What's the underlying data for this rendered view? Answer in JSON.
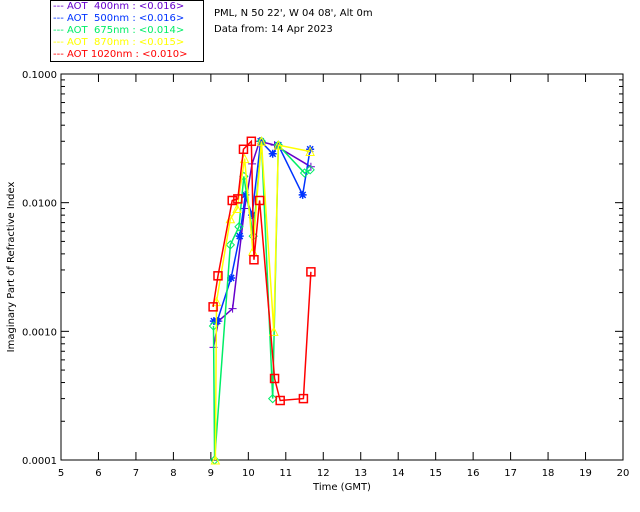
{
  "header": {
    "site": "PML, N 50 22', W 04 08', Alt 0m",
    "date": "Data from: 14 Apr 2023"
  },
  "chart_data": {
    "type": "line",
    "xlabel": "Time (GMT)",
    "ylabel": "Imaginary Part of Refractive Index",
    "xlim": [
      5,
      20
    ],
    "ylim": [
      0.0001,
      0.1
    ],
    "yscale": "log",
    "xticks": [
      "5",
      "6",
      "7",
      "8",
      "9",
      "10",
      "11",
      "12",
      "13",
      "14",
      "15",
      "16",
      "17",
      "18",
      "19",
      "20"
    ],
    "yticks": [
      "0.1000",
      "0.0100",
      "0.0010",
      "0.0001"
    ],
    "legend_position": "top-left (outside)",
    "grid": false,
    "series": [
      {
        "name": "AOT  400nm : <0.016>",
        "color": "#6600cc",
        "marker": "plus",
        "x": [
          9.07,
          9.2,
          9.58,
          9.9,
          10.1,
          10.3,
          10.7,
          11.67
        ],
        "y": [
          0.00075,
          0.0012,
          0.0015,
          0.009,
          0.02,
          0.03,
          0.028,
          0.019
        ]
      },
      {
        "name": "AOT  500nm : <0.016>",
        "color": "#0033ff",
        "marker": "asterisk",
        "x": [
          9.08,
          9.17,
          9.54,
          9.77,
          9.92,
          10.1,
          10.33,
          10.65,
          10.8,
          11.45,
          11.65
        ],
        "y": [
          0.0012,
          0.0012,
          0.0026,
          0.0055,
          0.0115,
          0.008,
          0.03,
          0.024,
          0.028,
          0.0115,
          0.026
        ]
      },
      {
        "name": "AOT  675nm : <0.014>",
        "color": "#00ee66",
        "marker": "diamond",
        "x": [
          9.07,
          9.1,
          9.52,
          9.75,
          9.88,
          10.13,
          10.35,
          10.65,
          10.8,
          11.5,
          11.65
        ],
        "y": [
          0.0011,
          0.0001,
          0.0047,
          0.0065,
          0.016,
          0.0055,
          0.03,
          0.0003,
          0.028,
          0.017,
          0.018
        ]
      },
      {
        "name": "AOT  870nm : <0.015>",
        "color": "#ffff00",
        "marker": "triangle",
        "x": [
          9.12,
          9.15,
          9.52,
          9.7,
          9.9,
          10.12,
          10.35,
          10.68,
          10.8,
          11.65
        ],
        "y": [
          0.0001,
          0.0017,
          0.0075,
          0.009,
          0.022,
          0.0042,
          0.03,
          0.001,
          0.028,
          0.025
        ]
      },
      {
        "name": "AOT 1020nm : <0.010>",
        "color": "#ff0000",
        "marker": "square",
        "x": [
          9.06,
          9.19,
          9.57,
          9.72,
          9.87,
          10.08,
          10.15,
          10.3,
          10.7,
          10.85,
          11.47,
          11.67
        ],
        "y": [
          0.00155,
          0.0027,
          0.0104,
          0.0107,
          0.026,
          0.03,
          0.0036,
          0.0104,
          0.00043,
          0.00029,
          0.0003,
          0.0029
        ]
      }
    ]
  }
}
